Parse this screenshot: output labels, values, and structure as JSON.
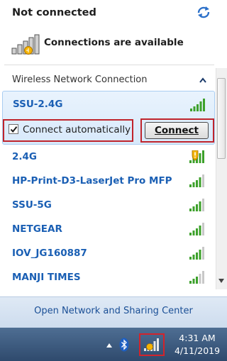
{
  "header": {
    "title": "Not connected",
    "availability": "Connections are available"
  },
  "section": {
    "label": "Wireless Network Connection"
  },
  "selected_network": {
    "name": "SSU-2.4G",
    "connect_auto_label": "Connect automatically",
    "connect_auto_checked": true,
    "connect_button": "Connect"
  },
  "networks": [
    {
      "name": "2.4G",
      "secured_warning": true
    },
    {
      "name": "HP-Print-D3-LaserJet Pro MFP",
      "secured_warning": false
    },
    {
      "name": "SSU-5G",
      "secured_warning": false
    },
    {
      "name": "NETGEAR",
      "secured_warning": false
    },
    {
      "name": "IOV_JG160887",
      "secured_warning": false
    },
    {
      "name": "MANJI TIMES",
      "secured_warning": false
    }
  ],
  "footer": {
    "link": "Open Network and Sharing Center"
  },
  "taskbar": {
    "time": "4:31 AM",
    "date": "4/11/2019"
  },
  "colors": {
    "network_name": "#1a5fb4",
    "highlight_border": "#c0242c",
    "signal_green": "#3da12b",
    "taskbar": "#3d5a7e"
  }
}
